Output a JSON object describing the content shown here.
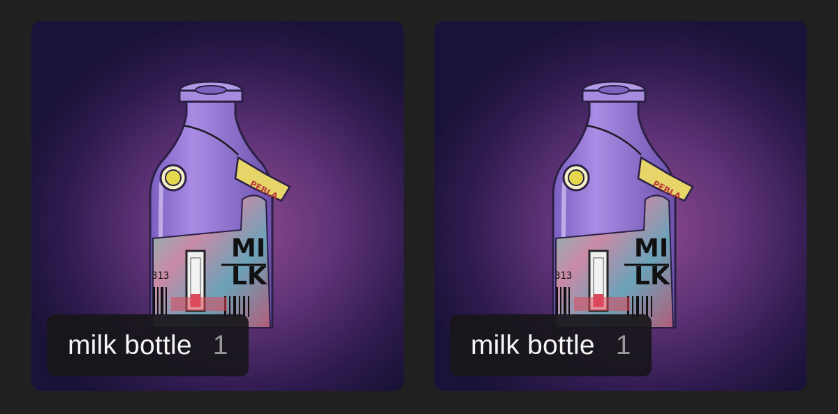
{
  "cards": [
    {
      "name": "milk bottle",
      "count": "1",
      "bottle": {
        "text_top": "MI",
        "text_bottom": "LK",
        "number": "313",
        "tag": "PEBLA"
      }
    },
    {
      "name": "milk bottle",
      "count": "1",
      "bottle": {
        "text_top": "MI",
        "text_bottom": "LK",
        "number": "313",
        "tag": "PEBLA"
      }
    }
  ],
  "colors": {
    "page_background": "#202020",
    "card_glow": "#8e4a8c",
    "card_edge": "#1a1238",
    "bottle_glass": "#9c7fd6",
    "tag": "#e8d56a",
    "label_background": "#18161a",
    "label_text": "#f6f6f6",
    "count_text": "#9a9a9a"
  }
}
